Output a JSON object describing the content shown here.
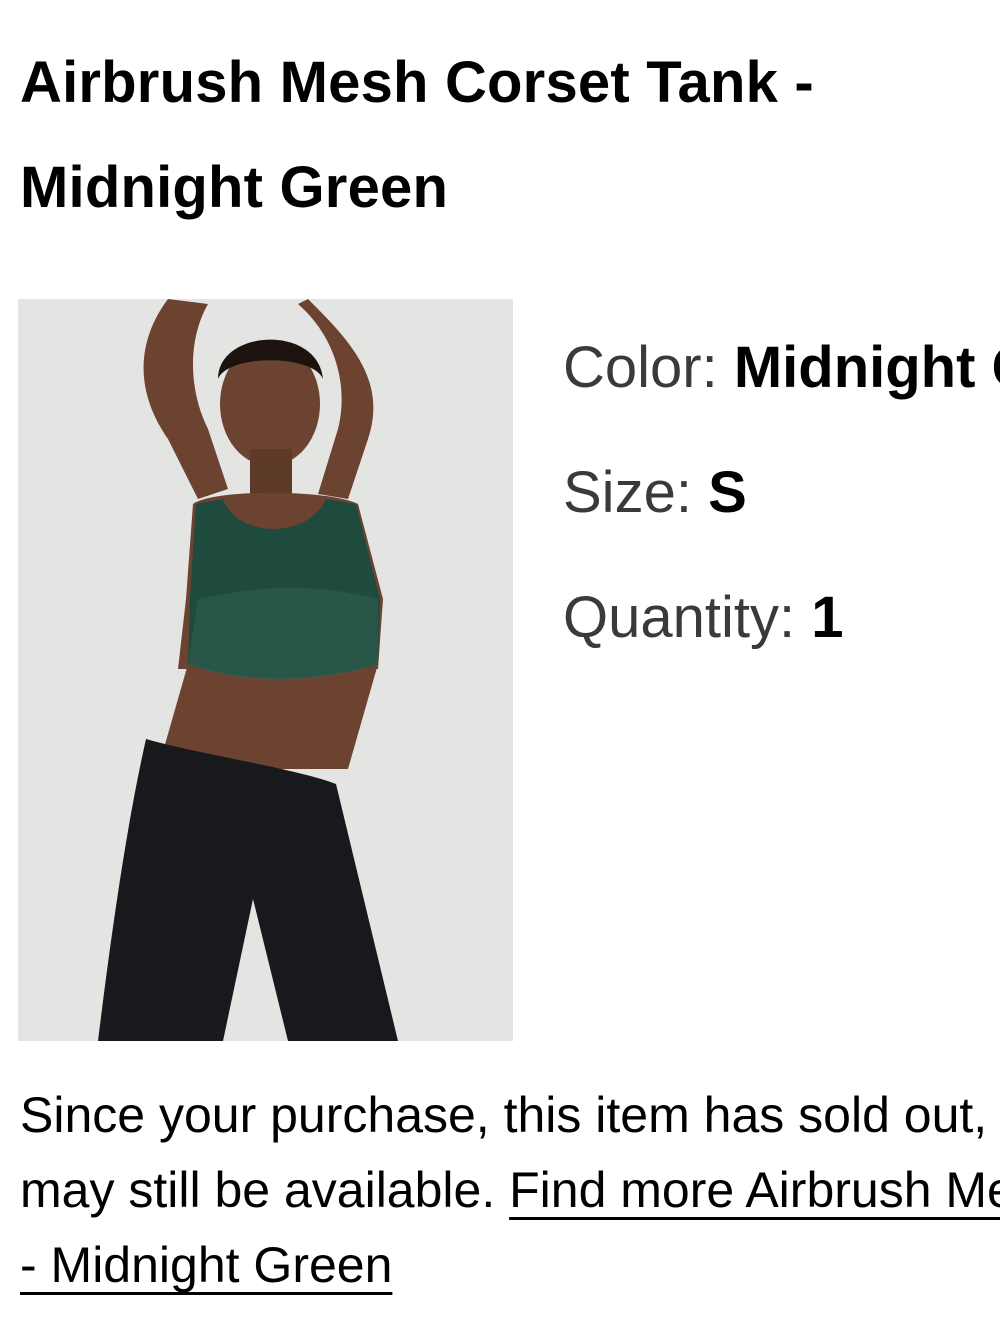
{
  "product": {
    "title_line1": "Airbrush Mesh Corset Tank -",
    "title_line2": "Midnight Green",
    "image_alt": "Model wearing the Airbrush Mesh Corset Tank in Midnight Green"
  },
  "attributes": {
    "color_label": "Color:",
    "color_value": "Midnight Green",
    "size_label": "Size:",
    "size_value": "S",
    "quantity_label": "Quantity:",
    "quantity_value": "1"
  },
  "notice": {
    "line1": "Since your purchase, this item has sold out, but similar items",
    "line2_text": "may still be available. ",
    "link_part1": "Find more Airbrush Mesh Corset Tank",
    "link_part2": "- Midnight Green"
  },
  "colors": {
    "top_green": "#1f4a3e",
    "pants_black": "#18191c",
    "skin": "#6b4330",
    "image_bg": "#e4e4e3"
  }
}
